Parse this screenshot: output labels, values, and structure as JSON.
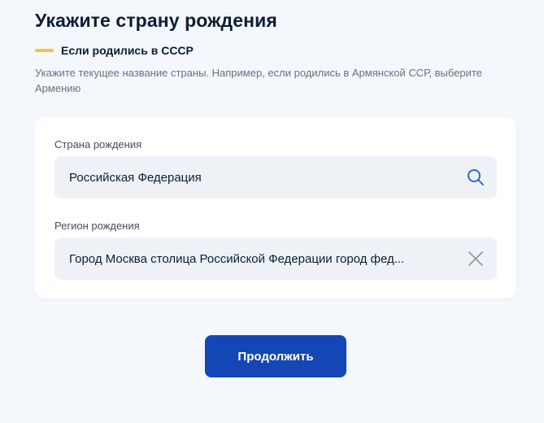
{
  "page": {
    "title": "Укажите страну рождения"
  },
  "hint": {
    "heading": "Если родились в СССР",
    "text": "Укажите текущее название страны. Например, если родились в Армянской ССР, выберите Армению"
  },
  "form": {
    "country": {
      "label": "Страна рождения",
      "value": "Российская Федерация",
      "icon": "search-icon"
    },
    "region": {
      "label": "Регион рождения",
      "value": "Город Москва столица Российской Федерации город фед...",
      "icon": "close-icon"
    }
  },
  "actions": {
    "continue_label": "Продолжить"
  },
  "colors": {
    "accent_yellow": "#f6c442",
    "primary_button": "#1447b5",
    "field_background": "#eef2f7",
    "icon_color": "#0d4cd3"
  }
}
